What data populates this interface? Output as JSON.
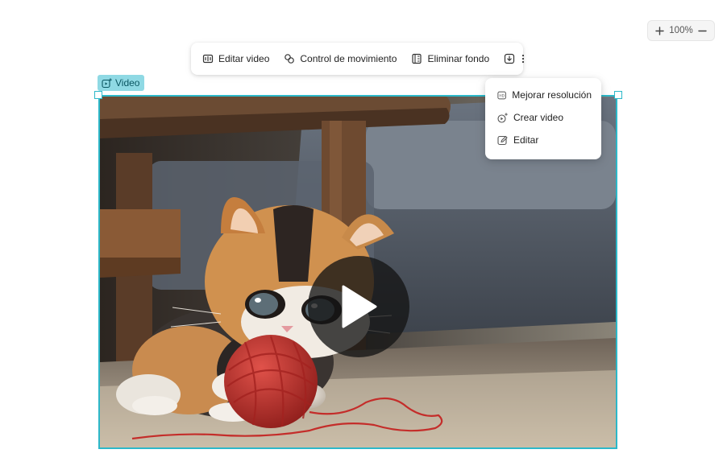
{
  "zoom": {
    "plus_icon": "plus-icon",
    "minus_icon": "minus-icon",
    "level": "100%"
  },
  "toolbar": {
    "items": [
      {
        "label": "Editar video",
        "icon": "edit-video-icon"
      },
      {
        "label": "Control de movimiento",
        "icon": "motion-control-icon"
      },
      {
        "label": "Eliminar fondo",
        "icon": "remove-background-icon"
      }
    ],
    "download_icon": "download-icon",
    "more_icon": "more-vertical-icon"
  },
  "video": {
    "tag_label": "Video",
    "tag_icon": "video-sparkle-icon",
    "play_icon": "play-icon"
  },
  "menu": {
    "items": [
      {
        "label": "Mejorar resolución",
        "icon": "hd-icon"
      },
      {
        "label": "Crear video",
        "icon": "create-video-icon"
      },
      {
        "label": "Editar",
        "icon": "edit-pencil-icon"
      }
    ]
  },
  "colors": {
    "accent": "#2cb8c9",
    "tag_bg": "#8fd9e4",
    "tag_text": "#0a5662",
    "yarn": "#c42d2a"
  }
}
